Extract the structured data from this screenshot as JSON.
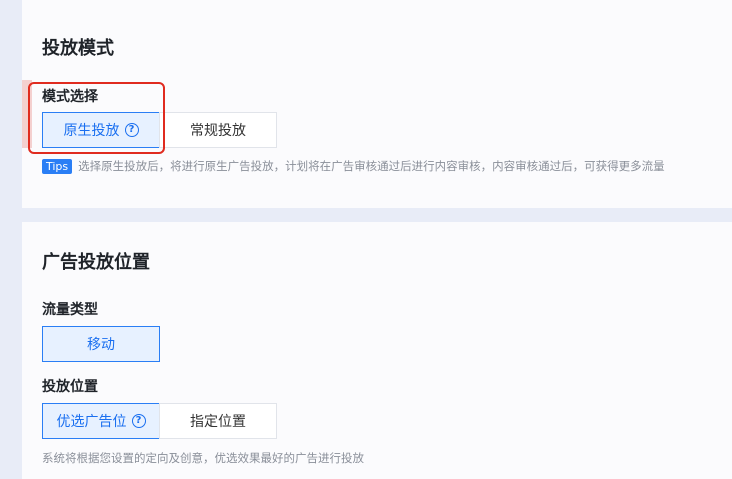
{
  "mode_section": {
    "title": "投放模式",
    "field_label": "模式选择",
    "options": [
      {
        "label": "原生投放",
        "selected": true,
        "has_help": true
      },
      {
        "label": "常规投放",
        "selected": false,
        "has_help": false
      }
    ],
    "tips_badge": "Tips",
    "tips_text": "选择原生投放后，将进行原生广告投放，计划将在广告审核通过后进行内容审核，内容审核通过后，可获得更多流量"
  },
  "placement_section": {
    "title": "广告投放位置",
    "traffic_label": "流量类型",
    "traffic_option": "移动",
    "position_label": "投放位置",
    "position_options": [
      {
        "label": "优选广告位",
        "selected": true,
        "has_help": true
      },
      {
        "label": "指定位置",
        "selected": false,
        "has_help": false
      }
    ],
    "hint": "系统将根据您设置的定向及创意，优选效果最好的广告进行投放"
  },
  "colors": {
    "accent": "#2a7ef5",
    "highlight": "#e02b1f",
    "muted_text": "#8a8f99"
  },
  "icons": {
    "help": "question-circle-icon"
  }
}
